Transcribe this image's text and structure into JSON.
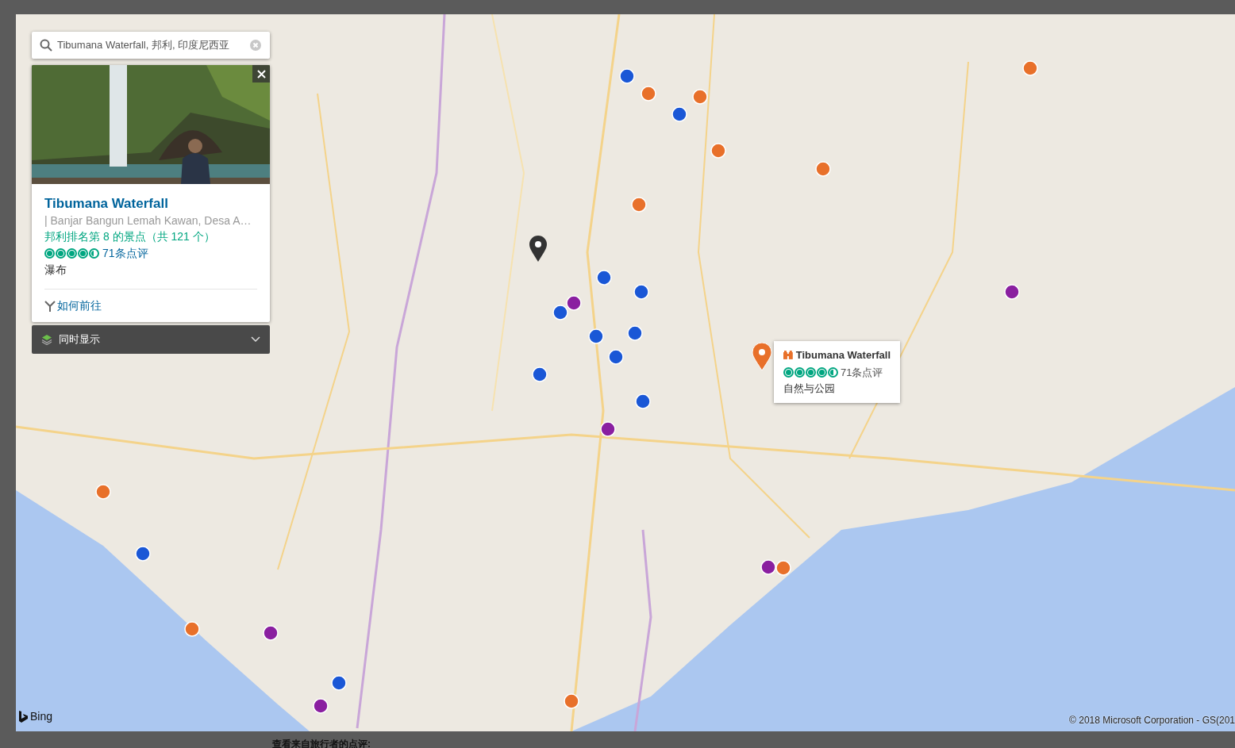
{
  "search": {
    "value": "Tibumana Waterfall, 邦利, 印度尼西亚"
  },
  "card": {
    "title": "Tibumana Waterfall",
    "address": "| Banjar Bangun Lemah Kawan, Desa A…",
    "ranking": "邦利排名第 8 的景点（共 121 个）",
    "stars": 4.5,
    "reviews": "71条点评",
    "category": "瀑布",
    "directions": "如何前往"
  },
  "also_show": {
    "label": "同时显示",
    "expanded": false
  },
  "popup": {
    "title": "Tibumana Waterfall",
    "stars": 4.5,
    "reviews": "71条点评",
    "category": "自然与公园"
  },
  "map": {
    "logo": "Bing",
    "copyright": "© 2018 Microsoft Corporation - GS(201"
  },
  "page_heading": "查看来自旅行者的点评:"
}
